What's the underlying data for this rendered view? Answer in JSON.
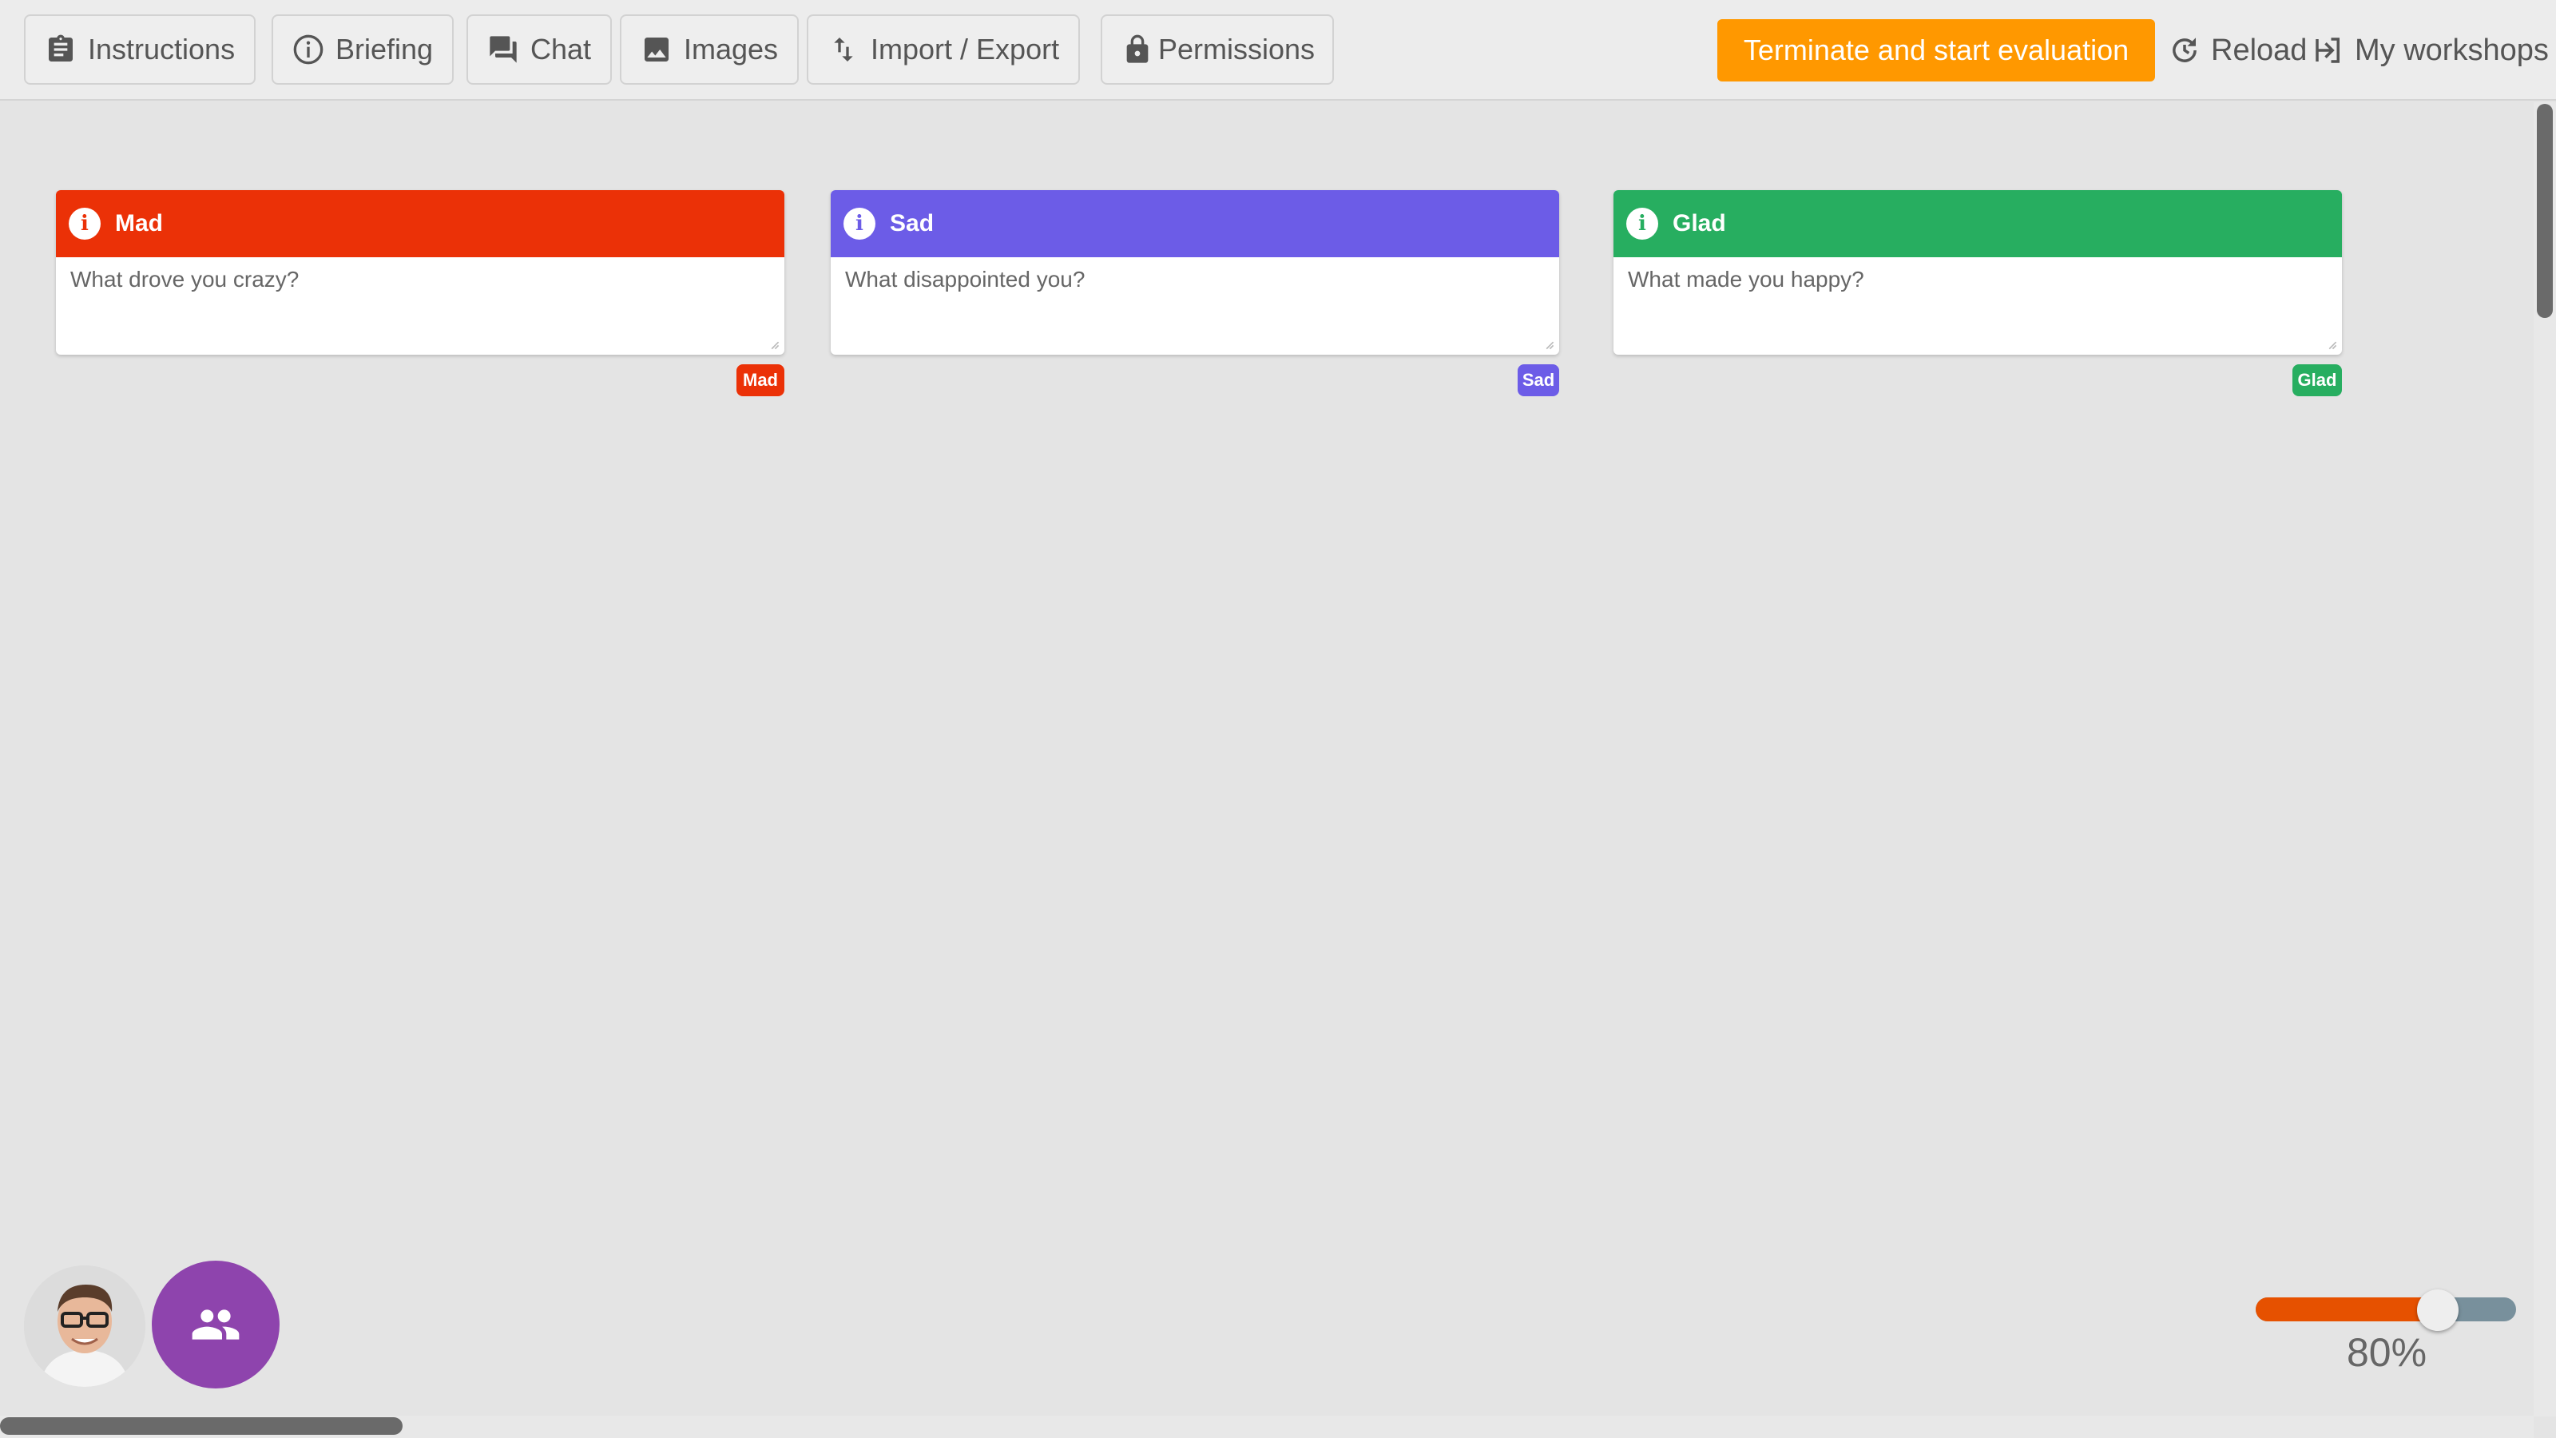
{
  "toolbar": {
    "buttons": [
      {
        "label": "Instructions",
        "icon": "clipboard-icon"
      },
      {
        "label": "Briefing",
        "icon": "info-circle-icon"
      },
      {
        "label": "Chat",
        "icon": "chat-icon"
      },
      {
        "label": "Images",
        "icon": "image-icon"
      },
      {
        "label": "Import / Export",
        "icon": "import-export-icon"
      },
      {
        "label": "Permissions",
        "icon": "lock-icon"
      }
    ],
    "terminate_label": "Terminate and start evaluation",
    "reload_label": "Reload",
    "my_workshops_label": "My workshops"
  },
  "columns": [
    {
      "title": "Mad",
      "placeholder": "What drove you crazy?",
      "tag": "Mad",
      "color": "#eb3107"
    },
    {
      "title": "Sad",
      "placeholder": "What disappointed you?",
      "tag": "Sad",
      "color": "#6c5ce7"
    },
    {
      "title": "Glad",
      "placeholder": "What made you happy?",
      "tag": "Glad",
      "color": "#27ae60"
    }
  ],
  "colors": {
    "accent": "#ff9800",
    "group_button": "#8e44ad",
    "zoom_fill": "#e65100",
    "zoom_track": "#78909c"
  },
  "participants": {
    "avatar_icon": "user-avatar",
    "group_icon": "group-icon"
  },
  "zoom": {
    "value": 0.8,
    "label": "80%"
  }
}
